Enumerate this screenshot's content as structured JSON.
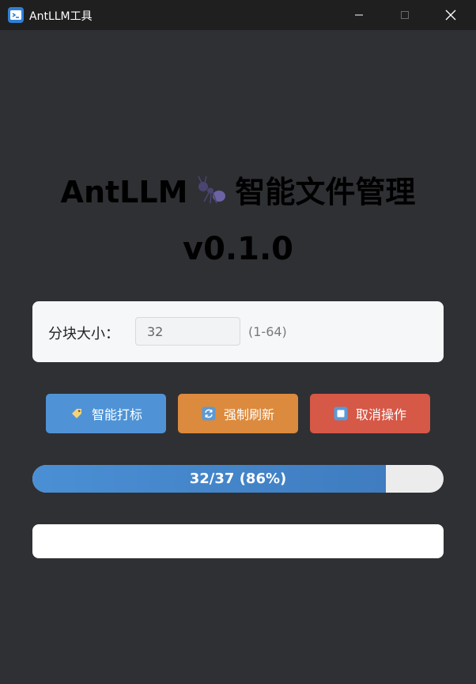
{
  "window": {
    "title": "AntLLM工具"
  },
  "heading": {
    "title_left": "AntLLM",
    "title_right": "智能文件管理",
    "version": "v0.1.0",
    "emoji": "ant"
  },
  "settings": {
    "chunk_label": "分块大小：",
    "chunk_value": "32",
    "chunk_range": "(1-64)"
  },
  "actions": {
    "tag_label": "智能打标",
    "refresh_label": "强制刷新",
    "cancel_label": "取消操作"
  },
  "progress": {
    "text": "32/37 (86%)",
    "fraction": 0.86
  },
  "log": {
    "text": ""
  },
  "colors": {
    "tag_button": "#4f93d6",
    "refresh_button": "#dc8a3d",
    "cancel_button": "#d65847",
    "progress_fill": "#4a8fd4",
    "background": "#2f3034"
  }
}
